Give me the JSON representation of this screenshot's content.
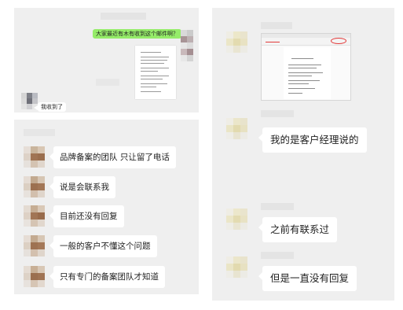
{
  "colors": {
    "chat_background": "#efefef",
    "outgoing_bubble": "#95ec69",
    "incoming_bubble": "#ffffff",
    "annotation_circle": "#e23a3a"
  },
  "panel_top_left": {
    "outgoing_message": "大家最近有木有收到这个邮件啊？",
    "incoming_reply": "我收到了",
    "attachment": "email-screenshot-image"
  },
  "panel_bottom_left": {
    "messages": [
      "品牌备案的团队 只让留了电话",
      "说是会联系我",
      "目前还没有回复",
      "一般的客户不懂这个问题",
      "只有专门的备案团队才知道"
    ]
  },
  "panel_right": {
    "attachment": "email-screenshot-image-annotated",
    "messages": [
      "我的是客户经理说的",
      "之前有联系过",
      "但是一直没有回复"
    ]
  }
}
